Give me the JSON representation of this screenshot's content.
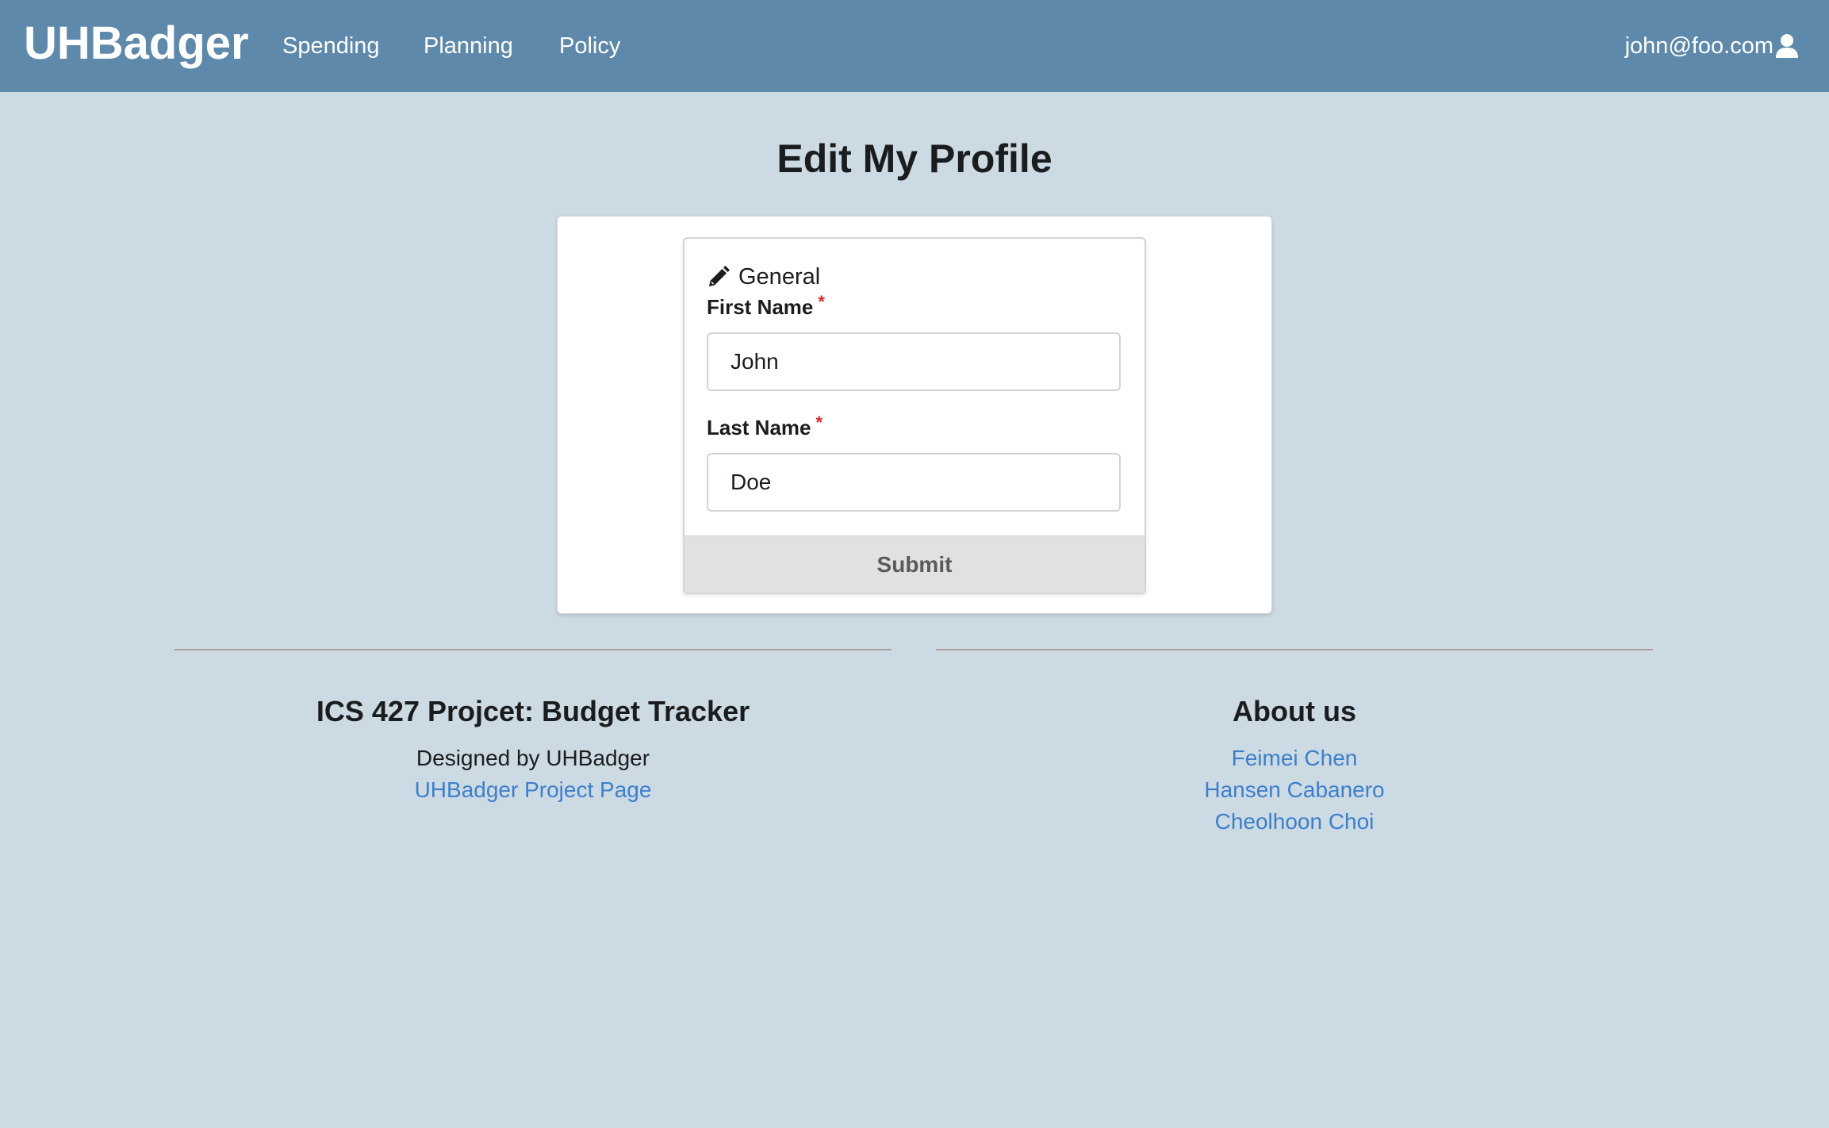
{
  "navbar": {
    "brand": "UHBadger",
    "items": [
      {
        "label": "Spending"
      },
      {
        "label": "Planning"
      },
      {
        "label": "Policy"
      }
    ],
    "user_email": "john@foo.com",
    "user_icon": "user-icon",
    "background_color": "#5f89ab"
  },
  "page": {
    "title": "Edit My Profile",
    "background_color": "#ccdae3"
  },
  "form": {
    "section_icon": "pencil-icon",
    "section_title": "General",
    "first_name": {
      "label": "First Name",
      "required_marker": "*",
      "value": "John"
    },
    "last_name": {
      "label": "Last Name",
      "required_marker": "*",
      "value": "Doe"
    },
    "submit_label": "Submit"
  },
  "footer": {
    "left": {
      "heading": "ICS 427 Projcet: Budget Tracker",
      "text": "Designed by UHBadger",
      "link": "UHBadger Project Page"
    },
    "right": {
      "heading": "About us",
      "members": [
        "Feimei Chen",
        "Hansen Cabanero",
        "Cheolhoon Choi"
      ]
    },
    "link_color": "#3d7fcc"
  }
}
